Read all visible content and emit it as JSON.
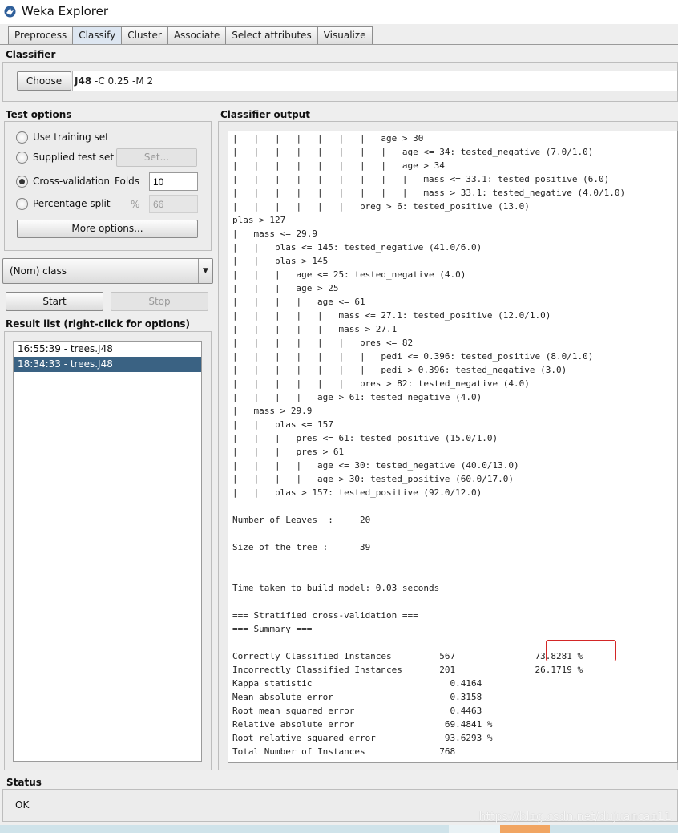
{
  "window": {
    "title": "Weka Explorer"
  },
  "tabs": [
    {
      "label": "Preprocess",
      "active": false
    },
    {
      "label": "Classify",
      "active": true
    },
    {
      "label": "Cluster",
      "active": false
    },
    {
      "label": "Associate",
      "active": false
    },
    {
      "label": "Select attributes",
      "active": false
    },
    {
      "label": "Visualize",
      "active": false
    }
  ],
  "classifier": {
    "section_label": "Classifier",
    "choose_label": "Choose",
    "name": "J48",
    "options": " -C 0.25 -M 2"
  },
  "test_options": {
    "section_label": "Test options",
    "use_training_set": "Use training set",
    "supplied_test_set": "Supplied test set",
    "set_button": "Set...",
    "cross_validation": "Cross-validation",
    "folds_label": "Folds",
    "folds_value": "10",
    "percentage_split": "Percentage split",
    "percent_symbol": "%",
    "percent_value": "66",
    "more_options": "More options...",
    "selected": "cross_validation"
  },
  "class_selector": {
    "value": "(Nom) class"
  },
  "run": {
    "start_label": "Start",
    "stop_label": "Stop"
  },
  "result_list": {
    "section_label": "Result list (right-click for options)",
    "items": [
      {
        "label": "16:55:39 - trees.J48",
        "selected": false
      },
      {
        "label": "18:34:33 - trees.J48",
        "selected": true
      }
    ]
  },
  "output": {
    "section_label": "Classifier output",
    "lines": [
      "|   |   |   |   |   |   |   age > 30",
      "|   |   |   |   |   |   |   |   age <= 34: tested_negative (7.0/1.0)",
      "|   |   |   |   |   |   |   |   age > 34",
      "|   |   |   |   |   |   |   |   |   mass <= 33.1: tested_positive (6.0)",
      "|   |   |   |   |   |   |   |   |   mass > 33.1: tested_negative (4.0/1.0)",
      "|   |   |   |   |   |   preg > 6: tested_positive (13.0)",
      "plas > 127",
      "|   mass <= 29.9",
      "|   |   plas <= 145: tested_negative (41.0/6.0)",
      "|   |   plas > 145",
      "|   |   |   age <= 25: tested_negative (4.0)",
      "|   |   |   age > 25",
      "|   |   |   |   age <= 61",
      "|   |   |   |   |   mass <= 27.1: tested_positive (12.0/1.0)",
      "|   |   |   |   |   mass > 27.1",
      "|   |   |   |   |   |   pres <= 82",
      "|   |   |   |   |   |   |   pedi <= 0.396: tested_positive (8.0/1.0)",
      "|   |   |   |   |   |   |   pedi > 0.396: tested_negative (3.0)",
      "|   |   |   |   |   |   pres > 82: tested_negative (4.0)",
      "|   |   |   |   age > 61: tested_negative (4.0)",
      "|   mass > 29.9",
      "|   |   plas <= 157",
      "|   |   |   pres <= 61: tested_positive (15.0/1.0)",
      "|   |   |   pres > 61",
      "|   |   |   |   age <= 30: tested_negative (40.0/13.0)",
      "|   |   |   |   age > 30: tested_positive (60.0/17.0)",
      "|   |   plas > 157: tested_positive (92.0/12.0)",
      "",
      "Number of Leaves  :     20",
      "",
      "Size of the tree :      39",
      "",
      "",
      "Time taken to build model: 0.03 seconds",
      "",
      "=== Stratified cross-validation ===",
      "=== Summary ===",
      "",
      "Correctly Classified Instances         567               73.8281 %",
      "Incorrectly Classified Instances       201               26.1719 %",
      "Kappa statistic                          0.4164",
      "Mean absolute error                      0.3158",
      "Root mean squared error                  0.4463",
      "Relative absolute error                 69.4841 %",
      "Root relative squared error             93.6293 %",
      "Total Number of Instances              768"
    ]
  },
  "status": {
    "section_label": "Status",
    "text": "OK"
  },
  "watermark": "https://blog.csdn.net/dujuancao11",
  "colors": {
    "selection": "#3a6283",
    "highlight_box": "#d32626",
    "active_tab": "#dde6f1"
  }
}
